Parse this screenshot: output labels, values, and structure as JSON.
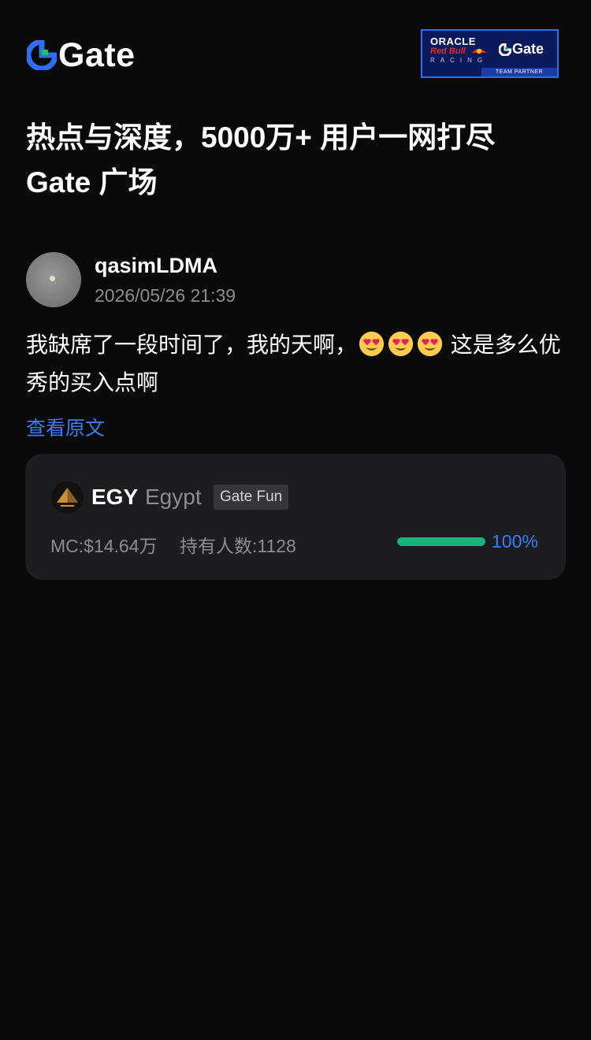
{
  "header": {
    "logo_text": "Gate",
    "partner": {
      "line1": "ORACLE",
      "line2": "Red Bull",
      "line3": "RACING",
      "brand": "Gate",
      "badge": "TEAM PARTNER"
    }
  },
  "headline": {
    "line1": "热点与深度，5000万+ 用户一网打尽",
    "line2": "Gate 广场"
  },
  "post": {
    "author": "qasimLDMA",
    "timestamp": "2026/05/26 21:39",
    "text_before": "我缺席了一段时间了，我的天啊，",
    "emoji_name": "heart-eyes-emoji",
    "text_after": " 这是多么优秀的买入点啊",
    "view_original": "查看原文"
  },
  "token_card": {
    "ticker": "EGY",
    "name": "Egypt",
    "tag": "Gate Fun",
    "market_cap": "MC:$14.64万",
    "holders": "持有人数:1128",
    "progress_percent": 100,
    "progress_label": "100%"
  },
  "colors": {
    "background": "#0a0a0b",
    "card": "#1c1d21",
    "accent_blue": "#3d7cf4",
    "progress_green": "#18b27c",
    "muted_text": "#8b8d93"
  }
}
